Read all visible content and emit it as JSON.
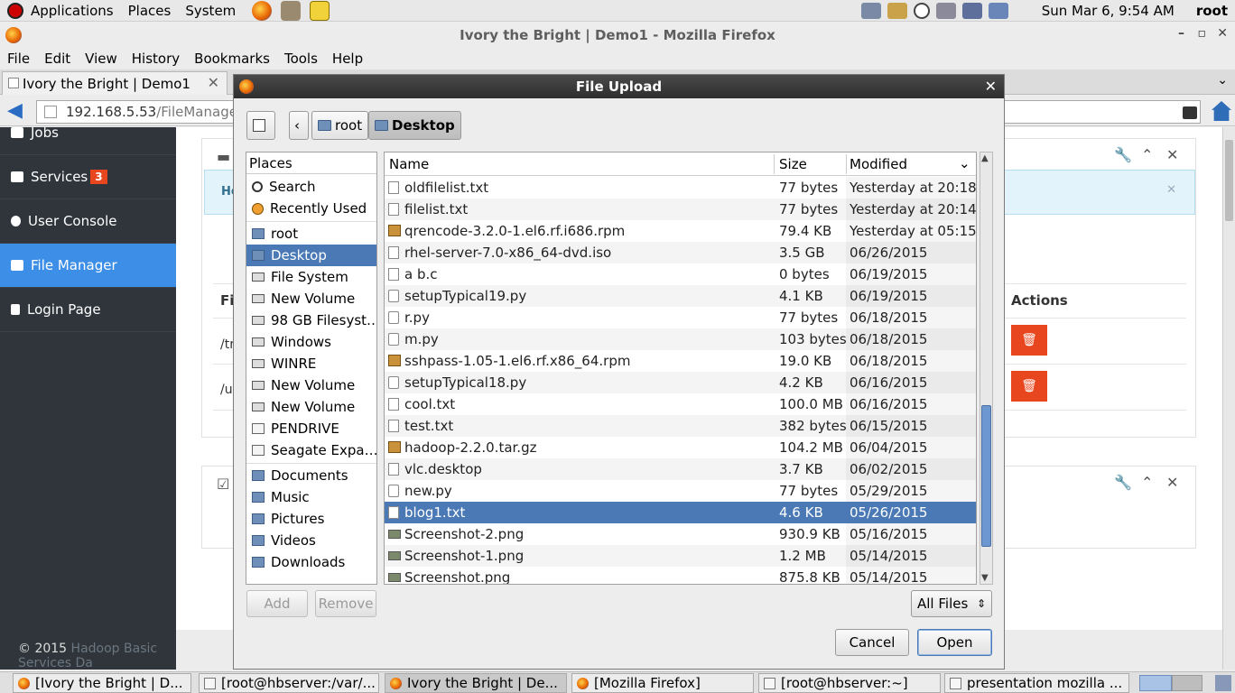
{
  "top_panel": {
    "menus": [
      "Applications",
      "Places",
      "System"
    ],
    "clock": "Sun Mar  6,  9:54 AM",
    "user": "root"
  },
  "firefox": {
    "title": "Ivory the Bright | Demo1 - Mozilla Firefox",
    "menus": [
      "File",
      "Edit",
      "View",
      "History",
      "Bookmarks",
      "Tools",
      "Help"
    ],
    "tab_label": "Ivory the Bright | Demo1",
    "url_host": "192.168.5.53",
    "url_path": "/FileManager"
  },
  "webpage": {
    "sidebar": {
      "items": [
        {
          "label": "Jobs"
        },
        {
          "label": "Services",
          "badge": "3"
        },
        {
          "label": "User Console"
        },
        {
          "label": "File Manager"
        },
        {
          "label": "Login Page"
        }
      ]
    },
    "alert_text": "He",
    "table": {
      "col_first": "Fi",
      "col_actions": "Actions",
      "rows": [
        "/tr",
        "/u"
      ]
    },
    "footer": {
      "copyright": "© 2015",
      "app_name": "Hadoop Basic Services Da"
    }
  },
  "dialog": {
    "title": "File Upload",
    "pathbar": [
      "root",
      "Desktop"
    ],
    "places_header": "Places",
    "places": [
      "Search",
      "Recently Used",
      "root",
      "Desktop",
      "File System",
      "New Volume",
      "98 GB Filesyst…",
      "Windows",
      "WINRE",
      "New Volume",
      "New Volume",
      "PENDRIVE",
      "Seagate Expa…",
      "Documents",
      "Music",
      "Pictures",
      "Videos",
      "Downloads"
    ],
    "columns": {
      "name": "Name",
      "size": "Size",
      "modified": "Modified"
    },
    "files": [
      {
        "name": "oldfilelist.txt",
        "size": "77 bytes",
        "modified": "Yesterday at 20:18"
      },
      {
        "name": "filelist.txt",
        "size": "77 bytes",
        "modified": "Yesterday at 20:14"
      },
      {
        "name": "qrencode-3.2.0-1.el6.rf.i686.rpm",
        "size": "79.4 KB",
        "modified": "Yesterday at 05:15"
      },
      {
        "name": "rhel-server-7.0-x86_64-dvd.iso",
        "size": "3.5 GB",
        "modified": "06/26/2015"
      },
      {
        "name": "a b.c",
        "size": "0 bytes",
        "modified": "06/19/2015"
      },
      {
        "name": "setupTypical19.py",
        "size": "4.1 KB",
        "modified": "06/19/2015"
      },
      {
        "name": "r.py",
        "size": "77 bytes",
        "modified": "06/18/2015"
      },
      {
        "name": "m.py",
        "size": "103 bytes",
        "modified": "06/18/2015"
      },
      {
        "name": "sshpass-1.05-1.el6.rf.x86_64.rpm",
        "size": "19.0 KB",
        "modified": "06/18/2015"
      },
      {
        "name": "setupTypical18.py",
        "size": "4.2 KB",
        "modified": "06/16/2015"
      },
      {
        "name": "cool.txt",
        "size": "100.0 MB",
        "modified": "06/16/2015"
      },
      {
        "name": "test.txt",
        "size": "382 bytes",
        "modified": "06/15/2015"
      },
      {
        "name": "hadoop-2.2.0.tar.gz",
        "size": "104.2 MB",
        "modified": "06/04/2015"
      },
      {
        "name": "vlc.desktop",
        "size": "3.7 KB",
        "modified": "06/02/2015"
      },
      {
        "name": "new.py",
        "size": "77 bytes",
        "modified": "05/29/2015"
      },
      {
        "name": "blog1.txt",
        "size": "4.6 KB",
        "modified": "05/26/2015"
      },
      {
        "name": "Screenshot-2.png",
        "size": "930.9 KB",
        "modified": "05/16/2015"
      },
      {
        "name": "Screenshot-1.png",
        "size": "1.2 MB",
        "modified": "05/14/2015"
      },
      {
        "name": "Screenshot.png",
        "size": "875.8 KB",
        "modified": "05/14/2015"
      }
    ],
    "selected_file": "blog1.txt",
    "buttons": {
      "add": "Add",
      "remove": "Remove",
      "filter": "All Files",
      "cancel": "Cancel",
      "open": "Open"
    }
  },
  "taskbar": [
    "[Ivory the Bright | D...",
    "[root@hbserver:/var/...",
    "Ivory the Bright | De...",
    "[Mozilla Firefox]",
    "[root@hbserver:~]",
    "presentation mozilla ..."
  ]
}
